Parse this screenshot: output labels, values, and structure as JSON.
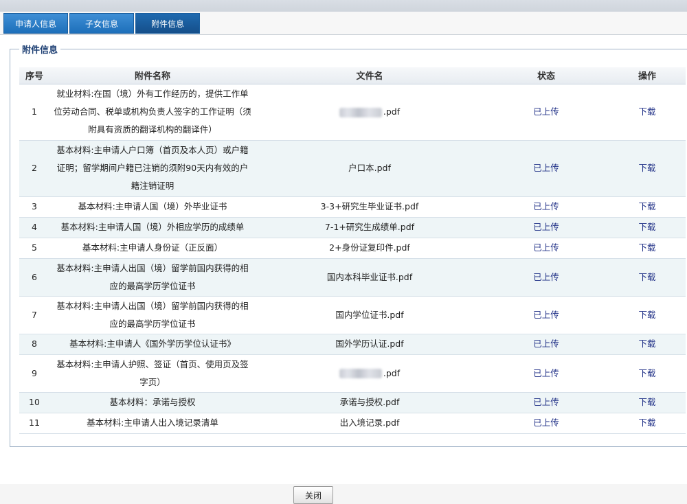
{
  "tabs": [
    {
      "label": "申请人信息"
    },
    {
      "label": "子女信息"
    },
    {
      "label": "附件信息"
    }
  ],
  "section": {
    "legend": "附件信息"
  },
  "table": {
    "headers": [
      "序号",
      "附件名称",
      "文件名",
      "状态",
      "操作"
    ],
    "rows": [
      {
        "no": "1",
        "name": "就业材料:在国（境）外有工作经历的，提供工作单位劳动合同、税单或机构负责人签字的工作证明（须附具有资质的翻译机构的翻译件）",
        "file": ".pdf",
        "status": "已上传",
        "action": "下载"
      },
      {
        "no": "2",
        "name": "基本材料:主申请人户口簿（首页及本人页）或户籍证明；留学期间户籍已注销的须附90天内有效的户籍注销证明",
        "file": "户口本.pdf",
        "status": "已上传",
        "action": "下载"
      },
      {
        "no": "3",
        "name": "基本材料:主申请人国（境）外毕业证书",
        "file": "3-3+研究生毕业证书.pdf",
        "status": "已上传",
        "action": "下载"
      },
      {
        "no": "4",
        "name": "基本材料:主申请人国（境）外相应学历的成绩单",
        "file": "7-1+研究生成绩单.pdf",
        "status": "已上传",
        "action": "下载"
      },
      {
        "no": "5",
        "name": "基本材料:主申请人身份证（正反面）",
        "file": "2+身份证复印件.pdf",
        "status": "已上传",
        "action": "下载"
      },
      {
        "no": "6",
        "name": "基本材料:主申请人出国（境）留学前国内获得的相应的最高学历学位证书",
        "file": "国内本科毕业证书.pdf",
        "status": "已上传",
        "action": "下载"
      },
      {
        "no": "7",
        "name": "基本材料:主申请人出国（境）留学前国内获得的相应的最高学历学位证书",
        "file": "国内学位证书.pdf",
        "status": "已上传",
        "action": "下载"
      },
      {
        "no": "8",
        "name": "基本材料:主申请人《国外学历学位认证书》",
        "file": "国外学历认证.pdf",
        "status": "已上传",
        "action": "下载"
      },
      {
        "no": "9",
        "name": "基本材料:主申请人护照、签证（首页、使用页及签字页）",
        "file": ".pdf",
        "status": "已上传",
        "action": "下载"
      },
      {
        "no": "10",
        "name": "基本材料：承诺与授权",
        "file": "承诺与授权.pdf",
        "status": "已上传",
        "action": "下载"
      },
      {
        "no": "11",
        "name": "基本材料:主申请人出入境记录清单",
        "file": "出入境记录.pdf",
        "status": "已上传",
        "action": "下载"
      }
    ]
  },
  "close_label": "关闭"
}
